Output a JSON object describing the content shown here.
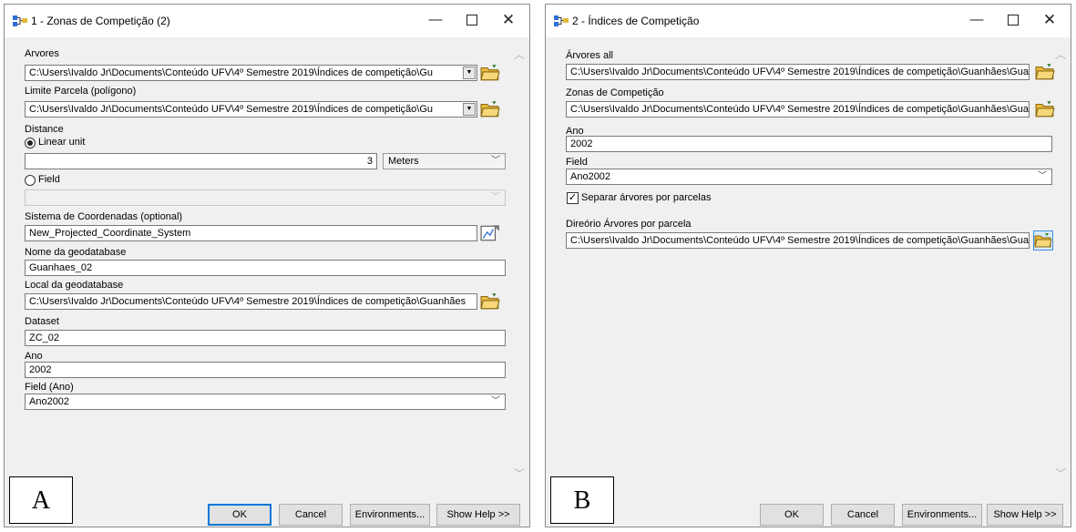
{
  "windowA": {
    "title": "1 - Zonas de Competição (2)",
    "arvores_label": "Arvores",
    "arvores_value": "C:\\Users\\Ivaldo Jr\\Documents\\Conteúdo UFV\\4º Semestre 2019\\Índices de competição\\Gu",
    "limite_label": "Limite Parcela (polígono)",
    "limite_value": "C:\\Users\\Ivaldo Jr\\Documents\\Conteúdo UFV\\4º Semestre 2019\\Índices de competição\\Gu",
    "distance_label": "Distance",
    "linear_unit_label": "Linear unit",
    "linear_value": "3",
    "unit_value": "Meters",
    "field_radio_label": "Field",
    "field_value": "",
    "sistema_label": "Sistema de Coordenadas (optional)",
    "sistema_value": "New_Projected_Coordinate_System",
    "nome_gdb_label": "Nome da geodatabase",
    "nome_gdb_value": "Guanhaes_02",
    "local_gdb_label": "Local da geodatabase",
    "local_gdb_value": "C:\\Users\\Ivaldo Jr\\Documents\\Conteúdo UFV\\4º Semestre 2019\\Índices de competição\\Guanhães",
    "dataset_label": "Dataset",
    "dataset_value": "ZC_02",
    "ano_label": "Ano",
    "ano_value": "2002",
    "field_ano_label": "Field (Ano)",
    "field_ano_value": "Ano2002",
    "panel_letter": "A"
  },
  "windowB": {
    "title": "2 - Índices de Competição",
    "arvores_all_label": "Árvores all",
    "arvores_all_value": "C:\\Users\\Ivaldo Jr\\Documents\\Conteúdo UFV\\4º Semestre 2019\\Índices de competição\\Guanhães\\Gua",
    "zonas_label": "Zonas de Competição",
    "zonas_value": "C:\\Users\\Ivaldo Jr\\Documents\\Conteúdo UFV\\4º Semestre 2019\\Índices de competição\\Guanhães\\Gua",
    "ano_label": "Ano",
    "ano_value": "2002",
    "field_label": "Field",
    "field_value": "Ano2002",
    "separar_label": "Separar árvores por parcelas",
    "separar_checked": true,
    "direorio_label": "Direório Árvores por parcela",
    "direorio_value": "C:\\Users\\Ivaldo Jr\\Documents\\Conteúdo UFV\\4º Semestre 2019\\Índices de competição\\Guanhães\\Gua",
    "panel_letter": "B"
  },
  "buttons": {
    "ok": "OK",
    "cancel": "Cancel",
    "environments": "Environments...",
    "show_help": "Show Help >>"
  },
  "titlebar": {
    "minimize": "—",
    "close": "✕"
  },
  "icons": {
    "tool": "model-tool-icon",
    "folder": "open-folder-icon",
    "coord": "coordinate-system-icon"
  },
  "colors": {
    "accent": "#0078d7",
    "folder": "#e8b93c"
  }
}
